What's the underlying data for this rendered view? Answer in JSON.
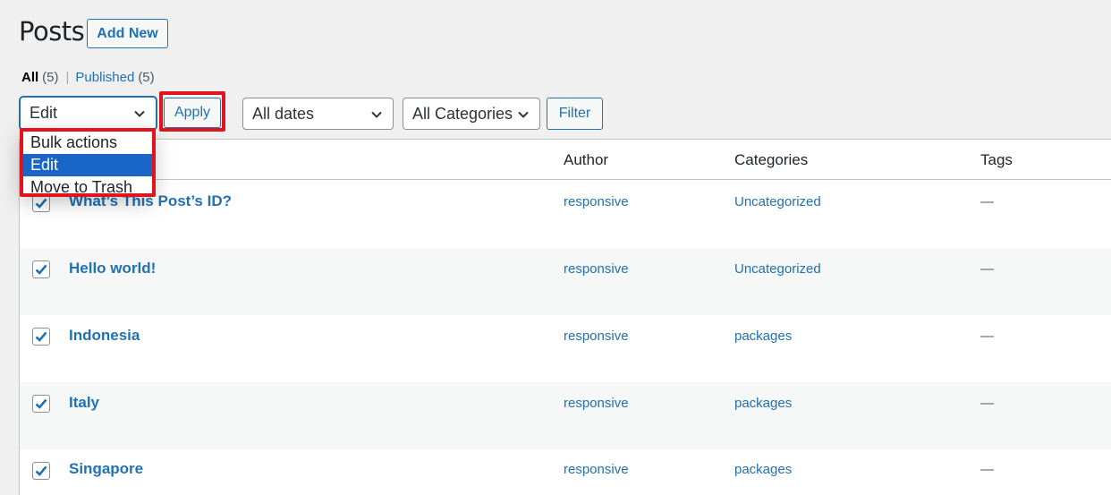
{
  "header": {
    "title": "Posts",
    "add_new": "Add New"
  },
  "views": {
    "all_label": "All",
    "all_count": "(5)",
    "separator": "|",
    "published_label": "Published",
    "published_count": "(5)"
  },
  "filters": {
    "bulk_actions_value": "Edit",
    "apply": "Apply",
    "dates_value": "All dates",
    "categories_value": "All Categories",
    "filter": "Filter"
  },
  "bulk_dropdown": {
    "options": [
      "Bulk actions",
      "Edit",
      "Move to Trash"
    ],
    "selected_index": 1
  },
  "table": {
    "columns": [
      "Author",
      "Categories",
      "Tags"
    ],
    "rows": [
      {
        "title": "What’s This Post’s ID?",
        "author": "responsive",
        "category": "Uncategorized",
        "tags": "—",
        "checked": true
      },
      {
        "title": "Hello world!",
        "author": "responsive",
        "category": "Uncategorized",
        "tags": "—",
        "checked": true
      },
      {
        "title": "Indonesia",
        "author": "responsive",
        "category": "packages",
        "tags": "—",
        "checked": true
      },
      {
        "title": "Italy",
        "author": "responsive",
        "category": "packages",
        "tags": "—",
        "checked": true
      },
      {
        "title": "Singapore",
        "author": "responsive",
        "category": "packages",
        "tags": "—",
        "checked": true
      }
    ]
  },
  "colors": {
    "link": "#2271b1",
    "highlight": "#e0141c",
    "dropdown_selected": "#1a66c7",
    "page_bg": "#f0f0f1"
  },
  "icons": {
    "select_arrow": "chevron-down-icon",
    "checkbox": "checkmark-icon"
  }
}
